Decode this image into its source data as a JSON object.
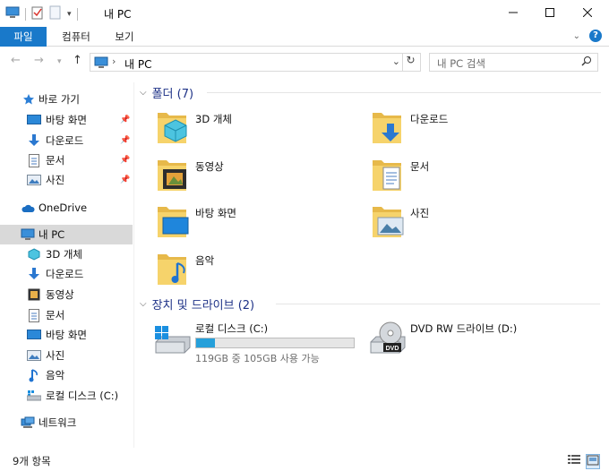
{
  "window": {
    "title": "내 PC",
    "controls": {
      "minimize": "minimize-icon",
      "maximize": "maximize-icon",
      "close": "close-icon"
    }
  },
  "ribbon": {
    "tabs": [
      {
        "label": "파일",
        "active": true
      },
      {
        "label": "컴퓨터",
        "active": false
      },
      {
        "label": "보기",
        "active": false
      }
    ],
    "accent": "#1979CA"
  },
  "address": {
    "path": "내 PC",
    "search_placeholder": "내 PC 검색"
  },
  "sidebar": {
    "quick_access": {
      "label": "바로 가기",
      "items": [
        {
          "label": "바탕 화면",
          "icon": "desktop-icon",
          "pinned": true
        },
        {
          "label": "다운로드",
          "icon": "download-icon",
          "pinned": true
        },
        {
          "label": "문서",
          "icon": "document-icon",
          "pinned": true
        },
        {
          "label": "사진",
          "icon": "pictures-icon",
          "pinned": true
        }
      ]
    },
    "onedrive": "OneDrive",
    "this_pc": {
      "label": "내 PC",
      "selected": true,
      "items": [
        {
          "label": "3D 개체",
          "icon": "3d-objects-icon"
        },
        {
          "label": "다운로드",
          "icon": "download-icon"
        },
        {
          "label": "동영상",
          "icon": "video-icon"
        },
        {
          "label": "문서",
          "icon": "document-icon"
        },
        {
          "label": "바탕 화면",
          "icon": "desktop-icon"
        },
        {
          "label": "사진",
          "icon": "pictures-icon"
        },
        {
          "label": "음악",
          "icon": "music-icon"
        },
        {
          "label": "로컬 디스크 (C:)",
          "icon": "local-disk-icon"
        }
      ]
    },
    "network": "네트워크"
  },
  "content": {
    "folders_group": {
      "title": "폴더 (7)"
    },
    "folders": [
      {
        "label": "3D 개체",
        "icon": "3d-objects-folder-icon"
      },
      {
        "label": "다운로드",
        "icon": "downloads-folder-icon"
      },
      {
        "label": "동영상",
        "icon": "videos-folder-icon"
      },
      {
        "label": "문서",
        "icon": "documents-folder-icon"
      },
      {
        "label": "바탕 화면",
        "icon": "desktop-folder-icon"
      },
      {
        "label": "사진",
        "icon": "pictures-folder-icon"
      },
      {
        "label": "음악",
        "icon": "music-folder-icon"
      }
    ],
    "devices_group": {
      "title": "장치 및 드라이브 (2)"
    },
    "drives": [
      {
        "label": "로컬 디스크 (C:)",
        "icon": "local-disk-drive-icon",
        "free_text": "119GB 중 105GB 사용 가능",
        "used_fraction": 0.118
      },
      {
        "label": "DVD RW 드라이브 (D:)",
        "icon": "dvd-drive-icon"
      }
    ]
  },
  "status": {
    "item_count": "9개 항목"
  }
}
